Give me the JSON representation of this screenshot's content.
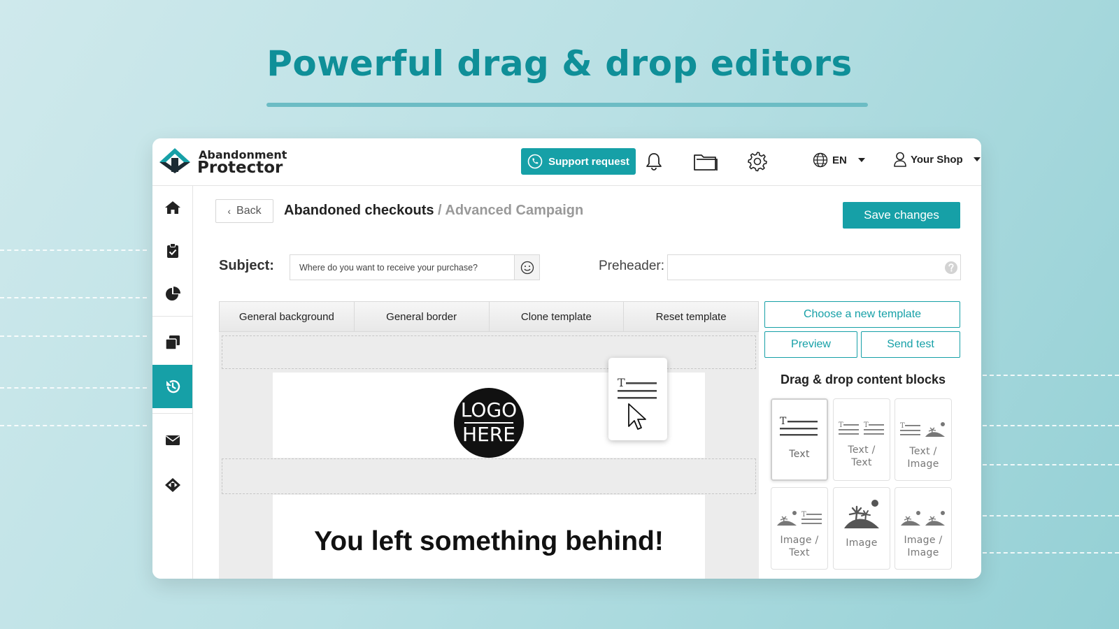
{
  "headline": "Powerful drag & drop editors",
  "brand": {
    "line1": "Abandonment",
    "line2": "Protector"
  },
  "topbar": {
    "support_label": "Support request",
    "language": "EN",
    "shop_label": "Your Shop",
    "icons": [
      "bell-icon",
      "folder-icon",
      "gear-icon",
      "globe-icon",
      "user-icon"
    ]
  },
  "sidebar": {
    "items": [
      {
        "icon": "home-icon"
      },
      {
        "icon": "clipboard-check-icon"
      },
      {
        "icon": "pie-chart-icon"
      },
      {
        "icon": "copy-icon"
      },
      {
        "icon": "history-icon",
        "active": true
      },
      {
        "icon": "envelope-icon"
      },
      {
        "icon": "brand-arrow-icon"
      }
    ]
  },
  "header": {
    "back_label": "Back",
    "breadcrumb_main": "Abandoned checkouts",
    "breadcrumb_sub": " / Advanced Campaign",
    "save_label": "Save changes"
  },
  "form": {
    "subject_label": "Subject:",
    "subject_value": "Where do you want to receive your purchase?",
    "preheader_label": "Preheader:",
    "preheader_value": ""
  },
  "toolbar": {
    "buttons": [
      "General background",
      "General border",
      "Clone template",
      "Reset template"
    ]
  },
  "canvas": {
    "logo_line1": "LOGO",
    "logo_line2": "HERE",
    "heading": "You left something behind!"
  },
  "right_panel": {
    "choose_template": "Choose a new template",
    "preview": "Preview",
    "send_test": "Send test",
    "blocks_title": "Drag & drop content blocks",
    "blocks": [
      {
        "label": "Text",
        "icon": "text-block-icon"
      },
      {
        "label": "Text / Text",
        "icon": "text-text-block-icon"
      },
      {
        "label": "Text / Image",
        "icon": "text-image-block-icon"
      },
      {
        "label": "Image / Text",
        "icon": "image-text-block-icon"
      },
      {
        "label": "Image",
        "icon": "image-block-icon"
      },
      {
        "label": "Image / Image",
        "icon": "image-image-block-icon"
      }
    ]
  },
  "colors": {
    "accent": "#16a0a7",
    "headline": "#0f8f98",
    "text": "#222222"
  }
}
